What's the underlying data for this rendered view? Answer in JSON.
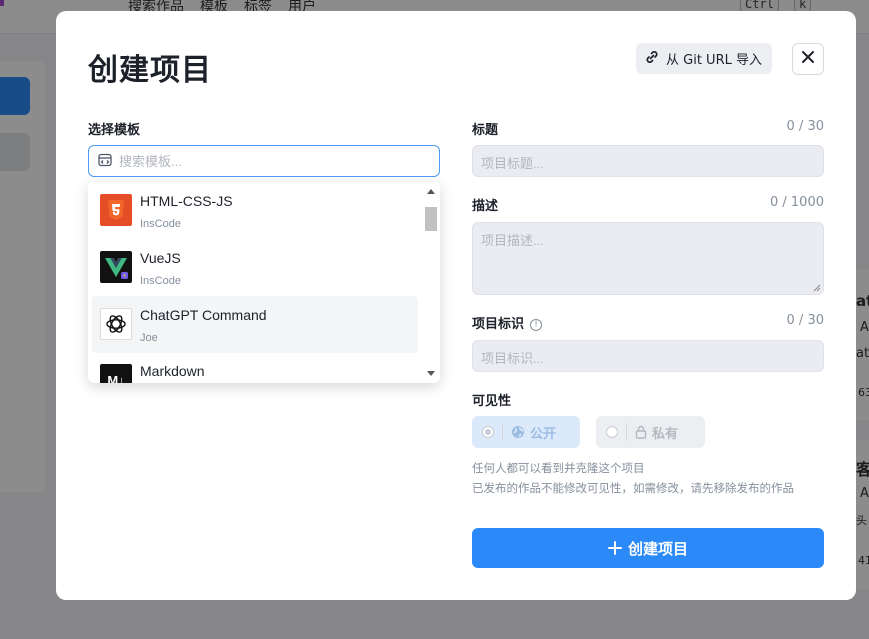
{
  "background": {
    "nav_items": [
      "搜索作品",
      "模板",
      "标签",
      "用户"
    ],
    "shortcut_keys": [
      "Ctrl",
      "k"
    ],
    "right_snippets": [
      "at",
      "A",
      "atG",
      "63",
      "客",
      "A",
      "头",
      "41"
    ]
  },
  "modal": {
    "title": "创建项目",
    "git_import_label": "从 Git URL 导入",
    "template": {
      "label": "选择模板",
      "search_placeholder": "搜索模板...",
      "items": [
        {
          "name": "HTML-CSS-JS",
          "author": "InsCode",
          "icon": "html5-icon"
        },
        {
          "name": "VueJS",
          "author": "InsCode",
          "icon": "vuejs-icon"
        },
        {
          "name": "ChatGPT Command",
          "author": "Joe",
          "icon": "openai-icon"
        },
        {
          "name": "Markdown",
          "author": "",
          "icon": "markdown-icon"
        }
      ]
    },
    "title_field": {
      "label": "标题",
      "counter": "0 / 30",
      "placeholder": "项目标题..."
    },
    "desc_field": {
      "label": "描述",
      "counter": "0 / 1000",
      "placeholder": "项目描述..."
    },
    "id_field": {
      "label": "项目标识",
      "counter": "0 / 30",
      "placeholder": "项目标识..."
    },
    "visibility": {
      "label": "可见性",
      "public_label": "公开",
      "private_label": "私有",
      "selected": "public",
      "hint_line1": "任何人都可以看到并克隆这个项目",
      "hint_line2": "已发布的作品不能修改可见性，如需修改，请先移除发布的作品"
    },
    "create_button_label": "创建项目"
  },
  "colors": {
    "primary": "#2b8af7",
    "html5": "#e44d26",
    "vue_green": "#41b883"
  }
}
